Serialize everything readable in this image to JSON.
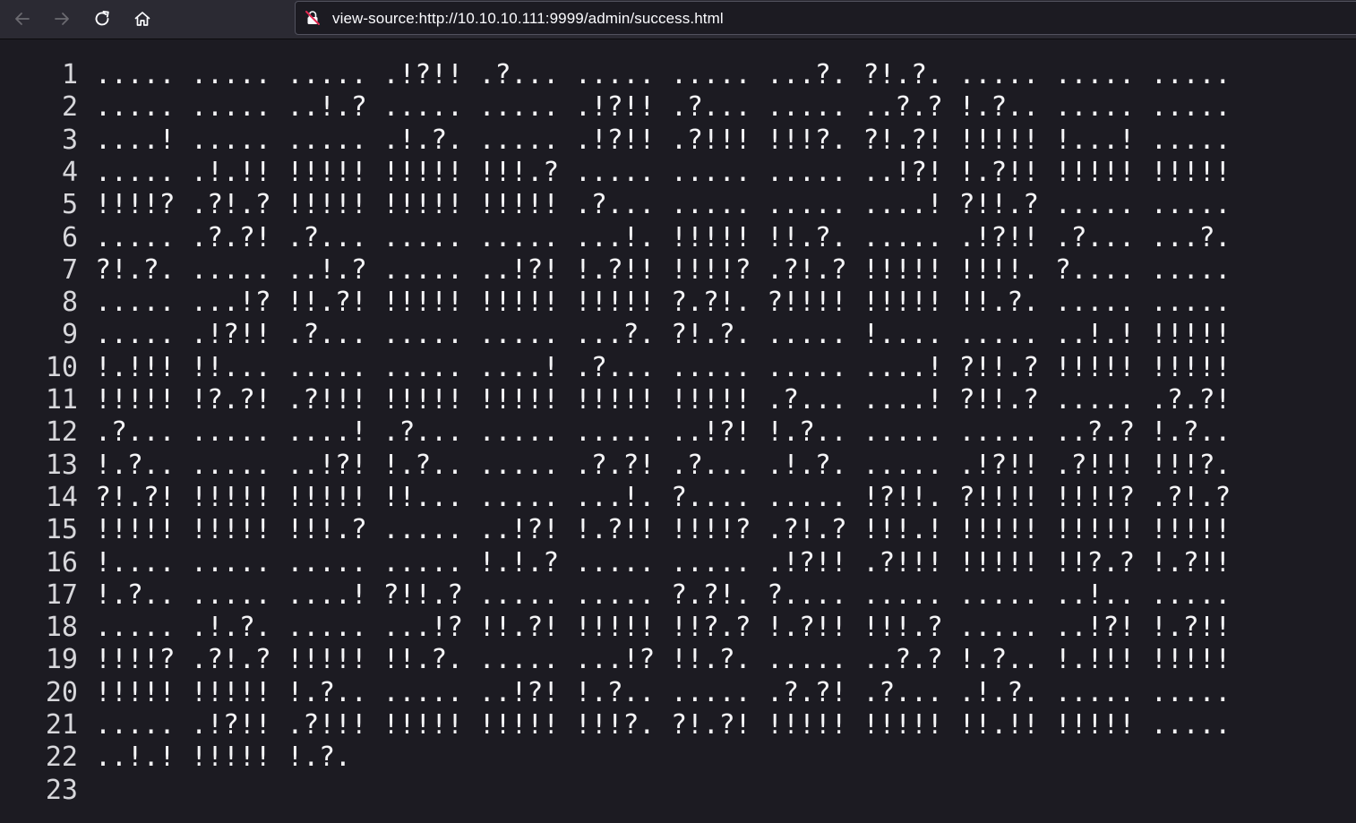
{
  "browser": {
    "url": "view-source:http://10.10.10.111:9999/admin/success.html",
    "back_icon": "arrow-left-icon",
    "forward_icon": "arrow-right-icon",
    "reload_icon": "reload-icon",
    "home_icon": "home-icon",
    "security_icon": "insecure-lock-icon"
  },
  "source": {
    "lines": [
      {
        "num": "1",
        "text": "..... ..... ..... .!?!! .?... ..... ..... ...?. ?!.?. ..... ..... ....."
      },
      {
        "num": "2",
        "text": "..... ..... ..!.? ..... ..... .!?!! .?... ..... ..?.? !.?.. ..... ....."
      },
      {
        "num": "3",
        "text": "....! ..... ..... .!.?. ..... .!?!! .?!!! !!!?. ?!.?! !!!!! !...! ....."
      },
      {
        "num": "4",
        "text": "..... .!.!! !!!!! !!!!! !!!.? ..... ..... ..... ..!?! !.?!! !!!!! !!!!!"
      },
      {
        "num": "5",
        "text": "!!!!? .?!.? !!!!! !!!!! !!!!! .?... ..... ..... ....! ?!!.? ..... ....."
      },
      {
        "num": "6",
        "text": "..... .?.?! .?... ..... ..... ...!. !!!!! !!.?. ..... .!?!! .?... ...?."
      },
      {
        "num": "7",
        "text": "?!.?. ..... ..!.? ..... ..!?! !.?!! !!!!? .?!.? !!!!! !!!!. ?.... ....."
      },
      {
        "num": "8",
        "text": "..... ...!? !!.?! !!!!! !!!!! !!!!! ?.?!. ?!!!! !!!!! !!.?. ..... ....."
      },
      {
        "num": "9",
        "text": "..... .!?!! .?... ..... ..... ...?. ?!.?. ..... !.... ..... ..!.! !!!!!"
      },
      {
        "num": "10",
        "text": "!.!!! !!... ..... ..... ....! .?... ..... ..... ....! ?!!.? !!!!! !!!!!"
      },
      {
        "num": "11",
        "text": "!!!!! !?.?! .?!!! !!!!! !!!!! !!!!! !!!!! .?... ....! ?!!.? ..... .?.?!"
      },
      {
        "num": "12",
        "text": ".?... ..... ....! .?... ..... ..... ..!?! !.?.. ..... ..... ..?.? !.?.."
      },
      {
        "num": "13",
        "text": "!.?.. ..... ..!?! !.?.. ..... .?.?! .?... .!.?. ..... .!?!! .?!!! !!!?."
      },
      {
        "num": "14",
        "text": "?!.?! !!!!! !!!!! !!... ..... ...!. ?.... ..... !?!!. ?!!!! !!!!? .?!.?"
      },
      {
        "num": "15",
        "text": "!!!!! !!!!! !!!.? ..... ..!?! !.?!! !!!!? .?!.? !!!.! !!!!! !!!!! !!!!!"
      },
      {
        "num": "16",
        "text": "!.... ..... ..... ..... !.!.? ..... ..... .!?!! .?!!! !!!!! !!?.? !.?!!"
      },
      {
        "num": "17",
        "text": "!.?.. ..... ....! ?!!.? ..... ..... ?.?!. ?.... ..... ..... ..!.. ....."
      },
      {
        "num": "18",
        "text": "..... .!.?. ..... ...!? !!.?! !!!!! !!?.? !.?!! !!!.? ..... ..!?! !.?!!"
      },
      {
        "num": "19",
        "text": "!!!!? .?!.? !!!!! !!.?. ..... ...!? !!.?. ..... ..?.? !.?.. !.!!! !!!!!"
      },
      {
        "num": "20",
        "text": "!!!!! !!!!! !.?.. ..... ..!?! !.?.. ..... .?.?! .?... .!.?. ..... ....."
      },
      {
        "num": "21",
        "text": "..... .!?!! .?!!! !!!!! !!!!! !!!?. ?!.?! !!!!! !!!!! !!.!! !!!!! ....."
      },
      {
        "num": "22",
        "text": "..!.! !!!!! !.?."
      },
      {
        "num": "23",
        "text": ""
      }
    ]
  }
}
